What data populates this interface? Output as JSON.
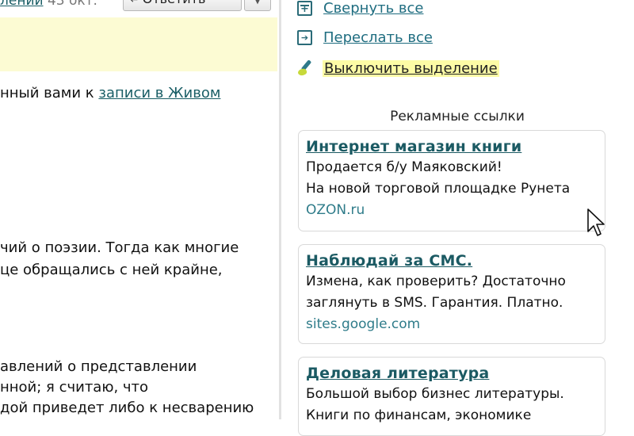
{
  "left": {
    "header_link": "лении",
    "header_count": "43 окт.",
    "reply_label": "Ответить",
    "reply_more": "▼",
    "line1_text": "нный вами к ",
    "line1_link": "записи в Живом",
    "line2": "чий о поэзии. Тогда как многие",
    "line3": "це обращались с ней крайне,",
    "line4": "авлений о представлении",
    "line5": "нной; я считаю, что",
    "line6": "дой приведет либо к несварению"
  },
  "sidebar": {
    "actions": [
      {
        "label": "Свернуть все",
        "icon": "collapse-all-icon"
      },
      {
        "label": "Переслать все",
        "icon": "forward-all-icon"
      },
      {
        "label": "Выключить выделение",
        "icon": "highlighter-icon"
      }
    ],
    "ads_title": "Рекламные ссылки",
    "ads": [
      {
        "title": "Интернет магазин книги",
        "line1": "Продается б/у Маяковский!",
        "line2": "На новой торговой площадке Рунета",
        "url": "OZON.ru"
      },
      {
        "title": "Наблюдай за СМС.",
        "line1": "Измена, как проверить? Достаточно",
        "line2": "заглянуть в SMS. Гарантия. Платно.",
        "url": "sites.google.com"
      },
      {
        "title": "Деловая литература",
        "line1": "Большой выбор бизнес литературы.",
        "line2": "Книги по финансам, экономике",
        "url": ""
      }
    ]
  },
  "colors": {
    "link": "#1f6d80",
    "highlight": "#fdfca6",
    "notice_band": "#fcfbd3",
    "ad_url": "#2f7c8a"
  }
}
